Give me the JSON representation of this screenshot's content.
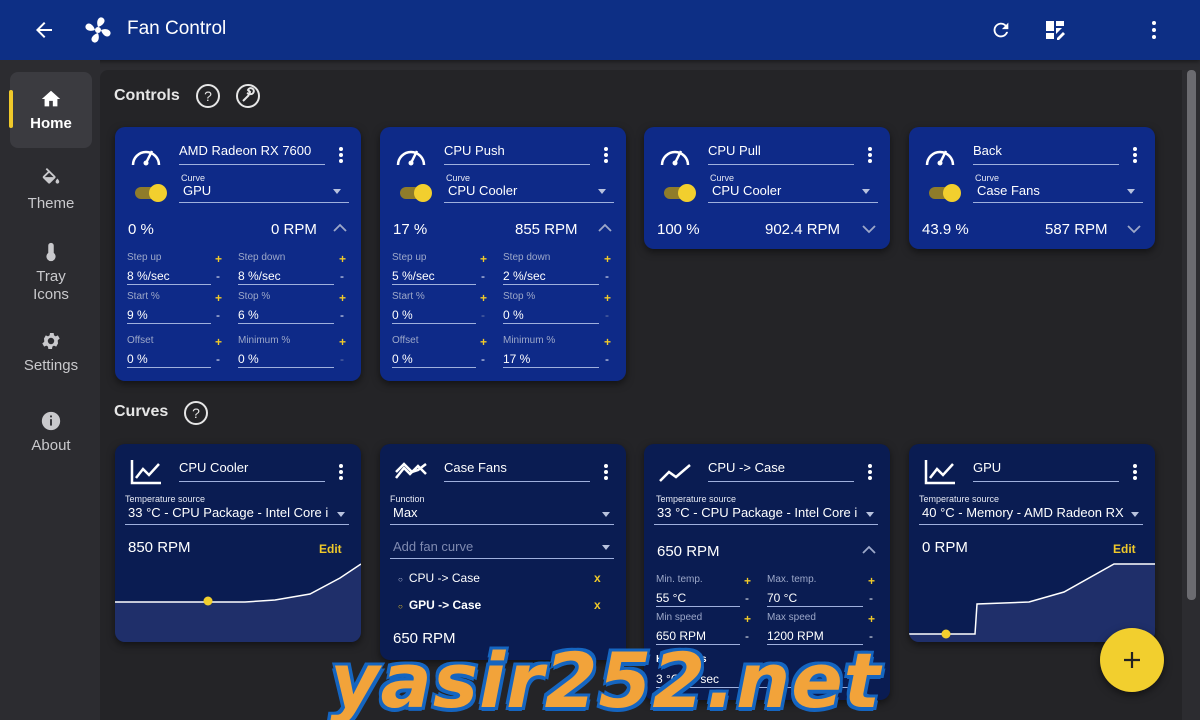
{
  "app": {
    "title": "Fan Control"
  },
  "sidebar": {
    "items": [
      {
        "label": "Home",
        "icon": "home-icon",
        "active": true
      },
      {
        "label": "Theme",
        "icon": "paint-bucket-icon"
      },
      {
        "label": "Tray Icons",
        "icon": "thermometer-icon"
      },
      {
        "label": "Settings",
        "icon": "gear-icon"
      },
      {
        "label": "About",
        "icon": "info-icon"
      }
    ]
  },
  "sections": {
    "controls": "Controls",
    "curves": "Curves"
  },
  "labels": {
    "curve": "Curve",
    "temp_source": "Temperature source",
    "function": "Function",
    "step_up": "Step up",
    "step_down": "Step down",
    "start_pct": "Start %",
    "stop_pct": "Stop %",
    "offset": "Offset",
    "minimum_pct": "Minimum %",
    "min_temp": "Min. temp.",
    "max_temp": "Max. temp.",
    "min_speed": "Min speed",
    "max_speed": "Max speed",
    "hysteresis": "Hysteresis",
    "edit": "Edit",
    "add_fan_curve": "Add fan curve",
    "plus": "+",
    "minus": "-",
    "remove": "x"
  },
  "controls": [
    {
      "name": "AMD Radeon RX 7600",
      "curve": "GPU",
      "percent": "0 %",
      "rpm": "0 RPM",
      "step_up": "8 %/sec",
      "step_down": "8 %/sec",
      "start": "9 %",
      "stop": "6 %",
      "offset": "0 %",
      "minimum": "0 %"
    },
    {
      "name": "CPU Push",
      "curve": "CPU Cooler",
      "percent": "17 %",
      "rpm": "855 RPM",
      "step_up": "5 %/sec",
      "step_down": "2 %/sec",
      "start": "0 %",
      "stop": "0 %",
      "offset": "0 %",
      "minimum": "17 %"
    },
    {
      "name": "CPU Pull",
      "curve": "CPU Cooler",
      "percent": "100 %",
      "rpm": "902.4 RPM"
    },
    {
      "name": "Back",
      "curve": "Case Fans",
      "percent": "43.9 %",
      "rpm": "587 RPM"
    }
  ],
  "curves": [
    {
      "name": "CPU Cooler",
      "source": "33 °C - CPU Package - Intel Core i",
      "rpm": "850 RPM"
    },
    {
      "name": "Case Fans",
      "function": "Max",
      "members": [
        "CPU -> Case",
        "GPU -> Case"
      ],
      "rpm": "650 RPM"
    },
    {
      "name": "CPU -> Case",
      "source": "33 °C - CPU Package - Intel Core i",
      "rpm": "650 RPM",
      "min_temp": "55 °C",
      "max_temp": "70 °C",
      "min_speed": "650 RPM",
      "max_speed": "1200 RPM",
      "hysteresis": "3 °C • 3 sec"
    },
    {
      "name": "GPU",
      "source": "40 °C - Memory - AMD Radeon RX",
      "rpm": "0 RPM"
    }
  ],
  "watermark": "yasir252.net",
  "colors": {
    "topbar": "#0d2f85",
    "card": "#0e2a88",
    "curve_card": "#0a1c52",
    "accent": "#f2cf2e"
  }
}
